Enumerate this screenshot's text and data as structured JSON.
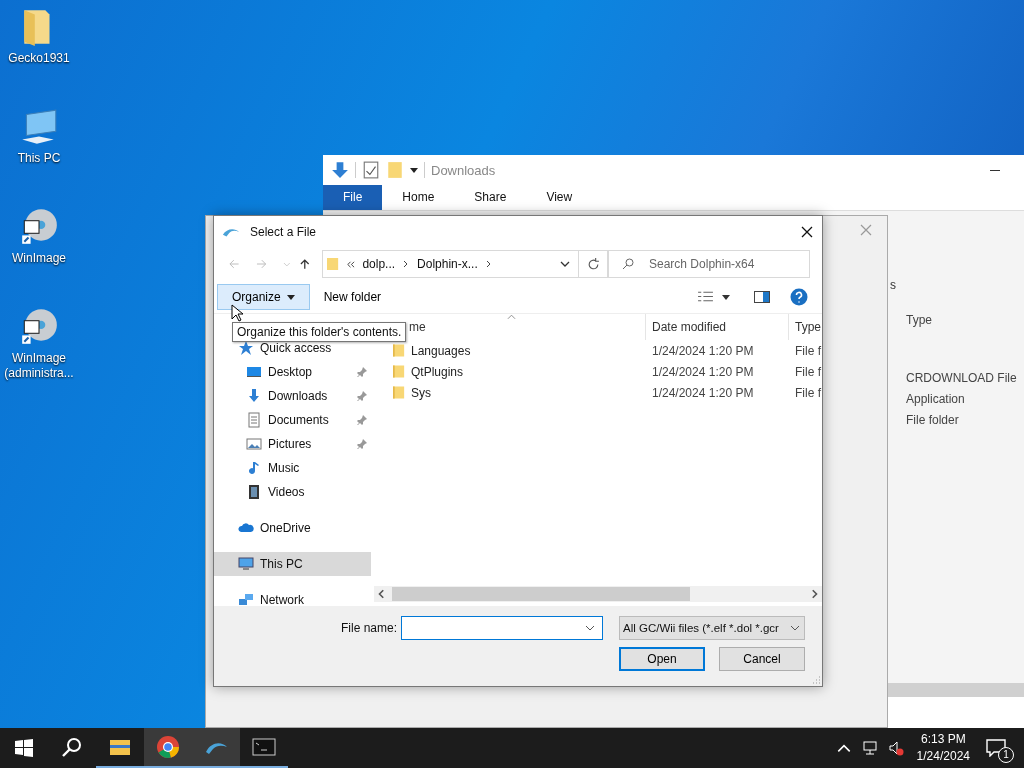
{
  "desktop": {
    "icons": [
      {
        "label": "Gecko1931",
        "kind": "folder"
      },
      {
        "label": "This PC",
        "kind": "pc"
      },
      {
        "label": "WinImage",
        "kind": "disc"
      },
      {
        "label": "WinImage (administra...",
        "kind": "disc"
      }
    ]
  },
  "explorer": {
    "title": "Downloads",
    "ribbon_tabs": [
      {
        "label": "File",
        "selected": true
      },
      {
        "label": "Home",
        "selected": false
      },
      {
        "label": "Share",
        "selected": false
      },
      {
        "label": "View",
        "selected": false
      }
    ],
    "address_fragment": "s",
    "column": "Type",
    "rows": [
      "CRDOWNLOAD File",
      "Application",
      "File folder"
    ]
  },
  "dialog": {
    "title": "Select a File",
    "breadcrumb": [
      "dolp...",
      "Dolphin-x..."
    ],
    "search": {
      "placeholder": "Search Dolphin-x64"
    },
    "toolbar": {
      "organize": "Organize",
      "new_folder": "New folder"
    },
    "tooltip": "Organize this folder's contents.",
    "sidebar": [
      {
        "label": "Quick access",
        "selected": false,
        "children": [
          {
            "label": "Desktop",
            "pinned": true,
            "selected": false
          },
          {
            "label": "Downloads",
            "pinned": true,
            "selected": false
          },
          {
            "label": "Documents",
            "pinned": true,
            "selected": false
          },
          {
            "label": "Pictures",
            "pinned": true,
            "selected": false
          },
          {
            "label": "Music",
            "pinned": false,
            "selected": false
          },
          {
            "label": "Videos",
            "pinned": false,
            "selected": false
          }
        ]
      },
      {
        "label": "OneDrive",
        "selected": false
      },
      {
        "label": "This PC",
        "selected": true
      },
      {
        "label": "Network",
        "selected": false
      }
    ],
    "columns": [
      "me",
      "Date modified",
      "Type"
    ],
    "rows": [
      {
        "name": "Languages",
        "date": "1/24/2024 1:20 PM",
        "type": "File f"
      },
      {
        "name": "QtPlugins",
        "date": "1/24/2024 1:20 PM",
        "type": "File f"
      },
      {
        "name": "Sys",
        "date": "1/24/2024 1:20 PM",
        "type": "File f"
      }
    ],
    "file_name_label": "File name:",
    "filter": "All GC/Wii files (*.elf *.dol *.gcr",
    "buttons": [
      {
        "label": "Open",
        "default": true
      },
      {
        "label": "Cancel",
        "default": false
      }
    ]
  },
  "taskbar": {
    "apps": [
      {
        "kind": "start",
        "selected": false
      },
      {
        "kind": "search",
        "selected": false
      },
      {
        "kind": "explorer",
        "selected": false
      },
      {
        "kind": "chrome",
        "selected": true
      },
      {
        "kind": "dolphin",
        "selected": true
      },
      {
        "kind": "terminal",
        "selected": false
      }
    ],
    "time": "6:13 PM",
    "date": "1/24/2024",
    "notifications": "1"
  }
}
